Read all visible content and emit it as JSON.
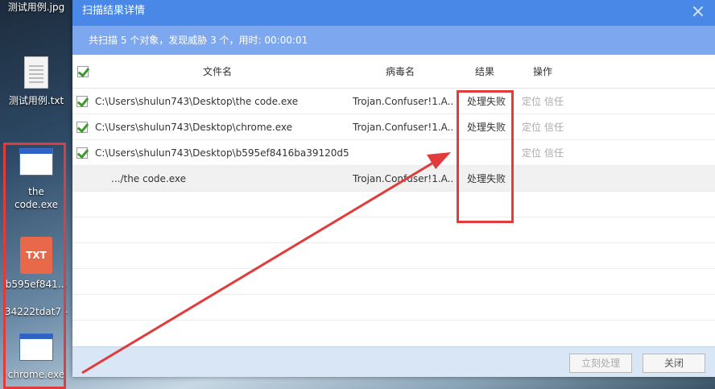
{
  "desktop": {
    "items": [
      {
        "label": "测试用例.jpg",
        "icon": "image-file-icon"
      },
      {
        "label": "测试用例.txt",
        "icon": "text-file-icon"
      },
      {
        "label": "the code.exe",
        "label_line1": "the",
        "label_line2": "code.exe",
        "icon": "exe-file-icon"
      },
      {
        "label": "b595ef841...",
        "icon": "txt-file-icon",
        "badge": "TXT"
      },
      {
        "label": "34222tdat7 -"
      },
      {
        "label": "chrome.exe",
        "icon": "exe-file-icon"
      }
    ]
  },
  "dialog": {
    "title": "扫描结果详情",
    "close_icon": "×",
    "summary": "共扫描 5 个对象，发现威胁 3 个，用时: 00:00:01",
    "columns": {
      "file": "文件名",
      "virus": "病毒名",
      "result": "结果",
      "ops": "操作"
    },
    "rows": [
      {
        "checked": true,
        "file": "C:\\Users\\shulun743\\Desktop\\the code.exe",
        "virus": "Trojan.Confuser!1.A...",
        "result": "处理失败",
        "op_locate": "定位",
        "op_trust": "信任"
      },
      {
        "checked": true,
        "file": "C:\\Users\\shulun743\\Desktop\\chrome.exe",
        "virus": "Trojan.Confuser!1.A...",
        "result": "处理失败",
        "op_locate": "定位",
        "op_trust": "信任"
      },
      {
        "checked": true,
        "file": "C:\\Users\\shulun743\\Desktop\\b595ef8416ba39120d5...",
        "virus": "",
        "result": "",
        "op_locate": "定位",
        "op_trust": "信任"
      },
      {
        "checked": false,
        "sub": true,
        "file": ".../the code.exe",
        "virus": "Trojan.Confuser!1.A...",
        "result": "处理失败"
      }
    ],
    "buttons": {
      "process_now": "立刻处理",
      "close": "关闭"
    }
  },
  "colors": {
    "title_bar": "#4a88e8",
    "summary_bar": "#7da8ef",
    "annotation_red": "#e23b3b",
    "check_green": "#3b9a2a"
  }
}
